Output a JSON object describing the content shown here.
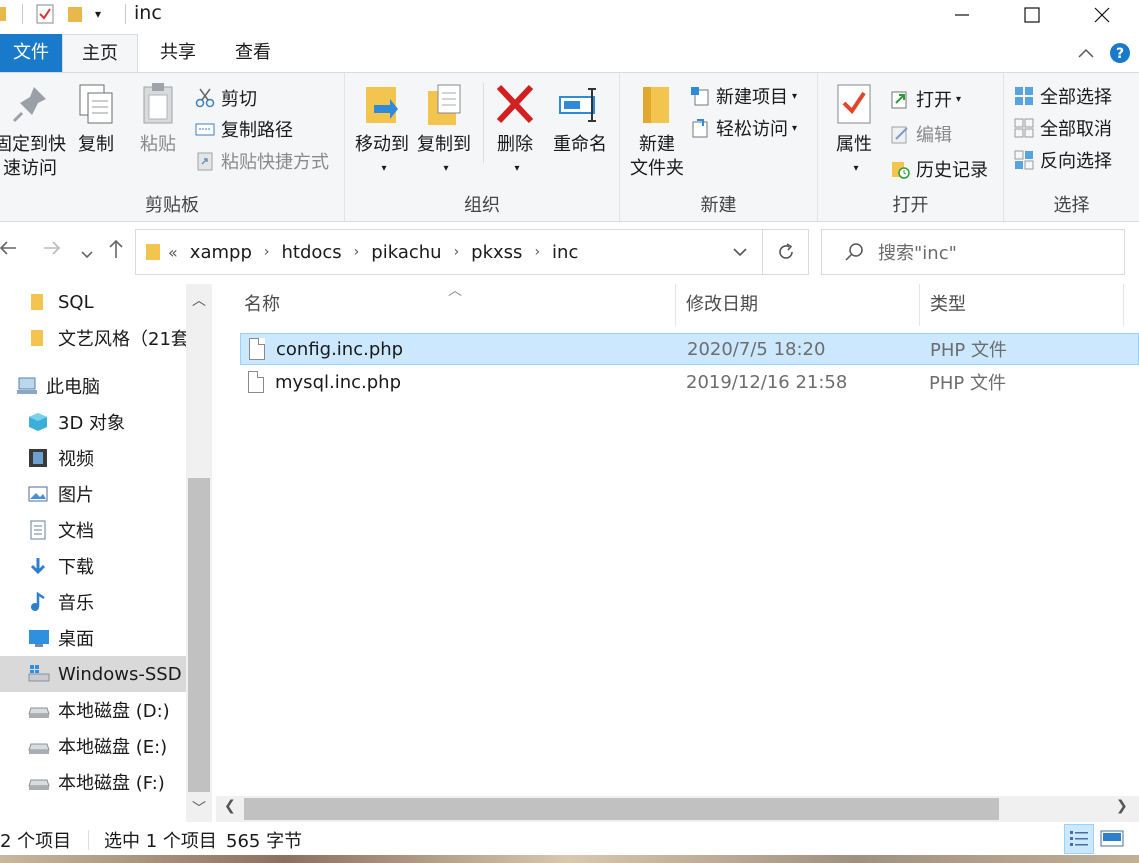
{
  "window": {
    "title": "inc"
  },
  "ribbon_tabs": [
    "文件",
    "主页",
    "共享",
    "查看"
  ],
  "ribbon": {
    "clipboard": {
      "label": "剪贴板",
      "pin_line1": "固定到快",
      "pin_line2": "速访问",
      "copy": "复制",
      "paste": "粘贴",
      "cut": "剪切",
      "copy_path": "复制路径",
      "paste_shortcut": "粘贴快捷方式"
    },
    "organize": {
      "label": "组织",
      "move_to": "移动到",
      "copy_to": "复制到",
      "delete": "删除",
      "rename": "重命名"
    },
    "new": {
      "label": "新建",
      "new_folder_line1": "新建",
      "new_folder_line2": "文件夹",
      "new_item": "新建项目",
      "easy_access": "轻松访问"
    },
    "open": {
      "label": "打开",
      "properties": "属性",
      "open": "打开",
      "edit": "编辑",
      "history": "历史记录"
    },
    "select": {
      "label": "选择",
      "select_all": "全部选择",
      "select_none": "全部取消",
      "invert": "反向选择"
    }
  },
  "address": {
    "overflow": "«",
    "crumbs": [
      "xampp",
      "htdocs",
      "pikachu",
      "pkxss",
      "inc"
    ]
  },
  "search": {
    "placeholder": "搜索\"inc\""
  },
  "nav_pane": {
    "items": [
      {
        "label": "SQL",
        "icon": "folder-icon"
      },
      {
        "label": "文艺风格（21套",
        "icon": "folder-icon"
      },
      {
        "label": "此电脑",
        "icon": "computer-icon"
      },
      {
        "label": "3D 对象",
        "icon": "3d-objects-icon"
      },
      {
        "label": "视频",
        "icon": "video-icon"
      },
      {
        "label": "图片",
        "icon": "pictures-icon"
      },
      {
        "label": "文档",
        "icon": "documents-icon"
      },
      {
        "label": "下载",
        "icon": "download-icon"
      },
      {
        "label": "音乐",
        "icon": "music-icon"
      },
      {
        "label": "桌面",
        "icon": "desktop-icon"
      },
      {
        "label": "Windows-SSD (",
        "icon": "system-drive-icon"
      },
      {
        "label": "本地磁盘 (D:)",
        "icon": "drive-icon"
      },
      {
        "label": "本地磁盘 (E:)",
        "icon": "drive-icon"
      },
      {
        "label": "本地磁盘 (F:)",
        "icon": "drive-icon"
      }
    ]
  },
  "columns": {
    "name": "名称",
    "date": "修改日期",
    "type": "类型"
  },
  "files": [
    {
      "name": "config.inc.php",
      "date": "2020/7/5 18:20",
      "type": "PHP 文件",
      "selected": true
    },
    {
      "name": "mysql.inc.php",
      "date": "2019/12/16 21:58",
      "type": "PHP 文件",
      "selected": false
    }
  ],
  "status": {
    "count": "2 个项目",
    "selected": "选中 1 个项目",
    "size": "565 字节"
  },
  "colors": {
    "accent": "#1979ca",
    "selection": "#cce8ff",
    "ribbon_bg": "#f5f6f7"
  }
}
